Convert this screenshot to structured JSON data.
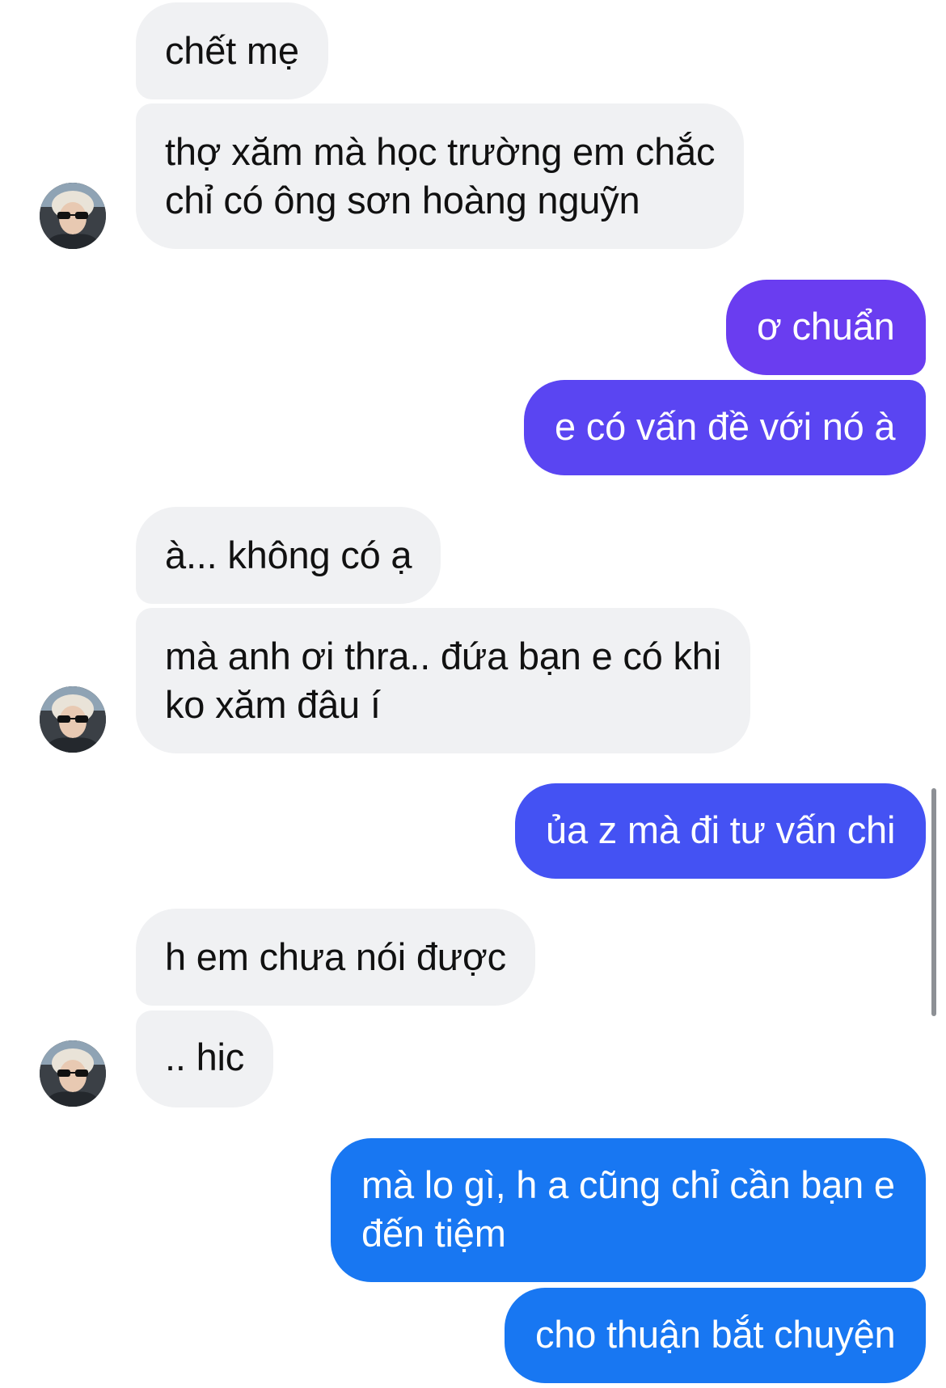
{
  "conversation": {
    "messages": [
      {
        "sender": "other",
        "text": "chết mẹ"
      },
      {
        "sender": "other",
        "line1": "thợ xăm mà học trường em chắc",
        "line2": "chỉ có ông sơn hoàng nguỹn"
      },
      {
        "sender": "me",
        "text": "ơ chuẩn"
      },
      {
        "sender": "me",
        "text": "e có vấn đề với nó à"
      },
      {
        "sender": "other",
        "text": "à... không có ạ"
      },
      {
        "sender": "other",
        "line1": "mà anh ơi thra.. đứa bạn e có khi",
        "line2": "ko xăm đâu í"
      },
      {
        "sender": "me",
        "text": "ủa z mà đi tư vấn chi"
      },
      {
        "sender": "other",
        "text": "h em chưa nói được"
      },
      {
        "sender": "other",
        "text": ".. hic"
      },
      {
        "sender": "me",
        "line1": "mà lo gì, h a cũng chỉ cần bạn e",
        "line2": "đến tiệm"
      },
      {
        "sender": "me",
        "text": "cho thuận bắt chuyện"
      }
    ]
  },
  "colors": {
    "incoming_bubble": "#f0f1f3",
    "outgoing_purple": "#6a3df0",
    "outgoing_violet": "#5a45f2",
    "outgoing_indigo": "#4452f3",
    "outgoing_blue": "#1877f2"
  },
  "icons": {
    "avatar": "contact-avatar-photo"
  }
}
